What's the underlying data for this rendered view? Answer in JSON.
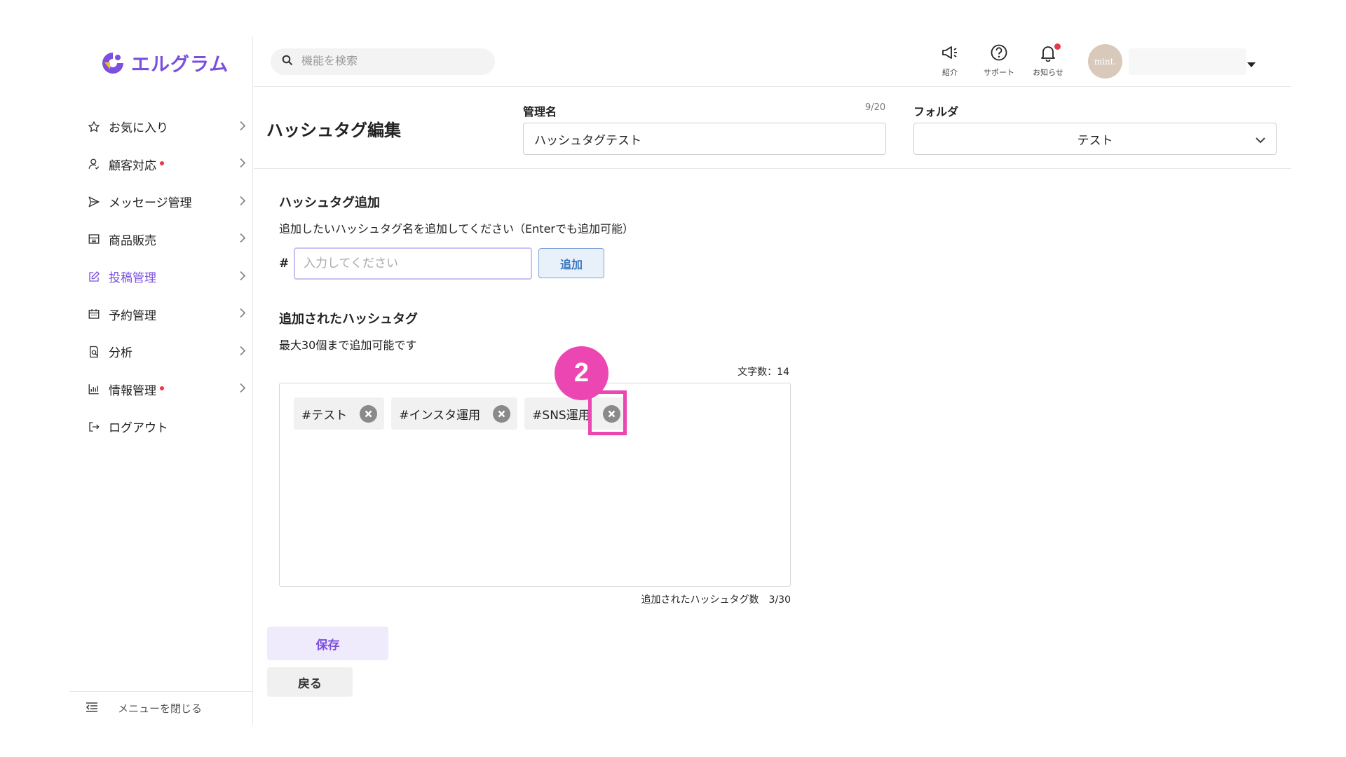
{
  "app": {
    "logo_text": "エルグラム",
    "brand_color": "#7b4fe0",
    "accent_pink": "#ec46b2",
    "alert_color": "#e53945"
  },
  "sidebar": {
    "items": [
      {
        "label": "お気に入り",
        "icon": "star-icon",
        "dot": false,
        "active": false
      },
      {
        "label": "顧客対応",
        "icon": "person-icon",
        "dot": true,
        "active": false
      },
      {
        "label": "メッセージ管理",
        "icon": "send-icon",
        "dot": false,
        "active": false
      },
      {
        "label": "商品販売",
        "icon": "store-icon",
        "dot": false,
        "active": false
      },
      {
        "label": "投稿管理",
        "icon": "edit-icon",
        "dot": false,
        "active": true
      },
      {
        "label": "予約管理",
        "icon": "calendar-icon",
        "dot": false,
        "active": false
      },
      {
        "label": "分析",
        "icon": "report-icon",
        "dot": false,
        "active": false
      },
      {
        "label": "情報管理",
        "icon": "bar-chart-icon",
        "dot": true,
        "active": false
      },
      {
        "label": "ログアウト",
        "icon": "logout-icon",
        "dot": false,
        "active": false
      }
    ],
    "collapse_label": "メニューを閉じる"
  },
  "header": {
    "search_placeholder": "機能を検索",
    "actions": [
      {
        "label": "紹介",
        "icon": "megaphone-icon"
      },
      {
        "label": "サポート",
        "icon": "help-icon"
      },
      {
        "label": "お知らせ",
        "icon": "bell-icon",
        "has_badge": true
      }
    ],
    "avatar_text": "mint."
  },
  "editor": {
    "title": "ハッシュタグ編集",
    "name_label": "管理名",
    "name_value": "ハッシュタグテスト",
    "name_counter": "9/20",
    "folder_label": "フォルダ",
    "folder_value": "テスト"
  },
  "add_section": {
    "title": "ハッシュタグ追加",
    "description": "追加したいハッシュタグ名を追加してください（Enterでも追加可能）",
    "prefix": "#",
    "input_placeholder": "入力してください",
    "add_button": "追加"
  },
  "added_section": {
    "title": "追加されたハッシュタグ",
    "description": "最大30個まで追加可能です",
    "char_count": "文字数：14",
    "tags": [
      "#テスト",
      "#インスタ運用",
      "#SNS運用"
    ],
    "tag_count_label": "追加されたハッシュタグ数　3/30"
  },
  "buttons": {
    "save": "保存",
    "back": "戻る"
  },
  "annotation": {
    "step_number": "2"
  }
}
